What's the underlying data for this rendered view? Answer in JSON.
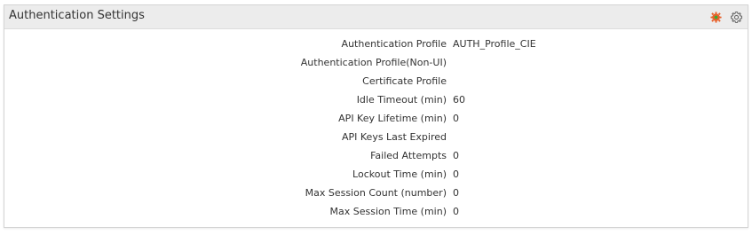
{
  "panel": {
    "title": "Authentication Settings",
    "icons": [
      {
        "name": "status-gear-icon",
        "color": "#e8622c",
        "accent": "#3aaa35"
      },
      {
        "name": "settings-gear-icon",
        "color": "#666666"
      }
    ]
  },
  "rows": [
    {
      "label": "Authentication Profile",
      "value": "AUTH_Profile_CIE"
    },
    {
      "label": "Authentication Profile(Non-UI)",
      "value": ""
    },
    {
      "label": "Certificate Profile",
      "value": ""
    },
    {
      "label": "Idle Timeout (min)",
      "value": "60"
    },
    {
      "label": "API Key Lifetime (min)",
      "value": "0"
    },
    {
      "label": "API Keys Last Expired",
      "value": ""
    },
    {
      "label": "Failed Attempts",
      "value": "0"
    },
    {
      "label": "Lockout Time (min)",
      "value": "0"
    },
    {
      "label": "Max Session Count (number)",
      "value": "0"
    },
    {
      "label": "Max Session Time (min)",
      "value": "0"
    }
  ]
}
